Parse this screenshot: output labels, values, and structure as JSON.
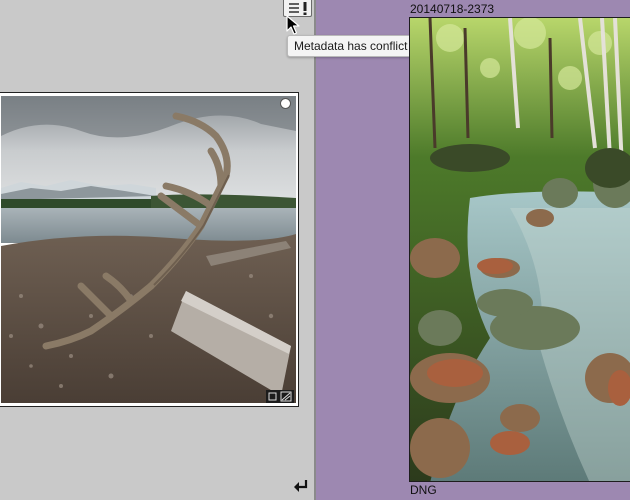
{
  "left_cell": {
    "tooltip": "Metadata has conflict",
    "metadata_icon": "metadata-conflict-icon",
    "selection_icon": "circle-select-icon",
    "return_icon": "return-arrow-icon",
    "thumbnail_subject": "antlers-on-beach-photo"
  },
  "right_cell": {
    "file_name": "20140718-2373",
    "file_extension": "DNG",
    "thumbnail_subject": "forest-stream-photo"
  },
  "colors": {
    "left_background": "#c9c9c9",
    "right_background": "#9d88b1",
    "tooltip_background": "#f4f4f4"
  }
}
